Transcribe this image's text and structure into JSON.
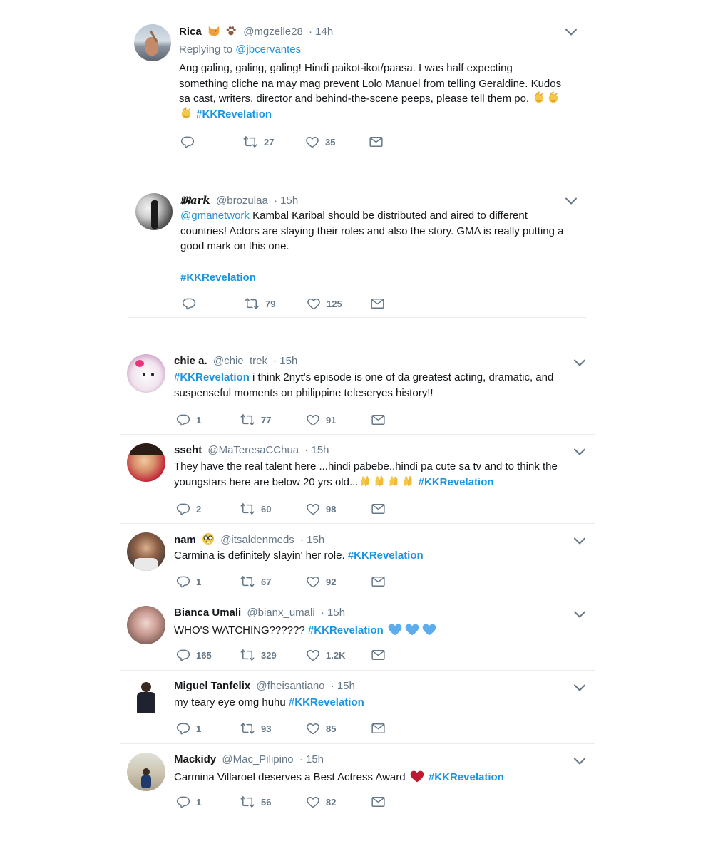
{
  "tweets": [
    {
      "name": "Rica",
      "name_emojis": [
        "cat-face-emoji",
        "paw-prints-emoji"
      ],
      "handle": "@mgzelle28",
      "time": "· 14h",
      "replying_label": "Replying to",
      "replying_handle": "@jbcervantes",
      "lines": [
        "Ang galing, galing, galing! Hindi paikot-ikot/paasa. I was half expecting",
        "something cliche na may mag prevent Lolo Manuel from telling Geraldine. Kudos",
        "sa cast, writers, director and behind-the-scene peeps, please tell them po."
      ],
      "hashtag": "#KKRevelation",
      "reply_count": "",
      "retweet_count": "27",
      "like_count": "35"
    },
    {
      "name": "𝕸ark",
      "handle": "@brozulaa",
      "time": "· 15h",
      "mention": "@gmanetwork",
      "lines": [
        "Kambal Karibal should be distributed and aired to different",
        "countries! Actors are slaying their roles and also the story. GMA is really putting a",
        "good mark on this one."
      ],
      "hashtag": "#KKRevelation",
      "reply_count": "",
      "retweet_count": "79",
      "like_count": "125"
    },
    {
      "name": "chie a.",
      "handle": "@chie_trek",
      "time": "· 15h",
      "hashtag": "#KKRevelation",
      "lines": [
        "i think 2nyt's episode is one of da greatest acting, dramatic, and",
        "suspenseful moments on philippine teleseryes history!!"
      ],
      "reply_count": "1",
      "retweet_count": "77",
      "like_count": "91"
    },
    {
      "name": "sseht",
      "handle": "@MaTeresaCChua",
      "time": "· 15h",
      "lines": [
        "They have the real talent here ...hindi pabebe..hindi pa cute sa tv and to think the",
        "youngstars here are below 20 yrs old..."
      ],
      "hashtag": "#KKRevelation",
      "reply_count": "2",
      "retweet_count": "60",
      "like_count": "98"
    },
    {
      "name": "nam",
      "handle": "@itsaldenmeds",
      "time": "· 15h",
      "text": "Carmina is definitely slayin' her role.",
      "hashtag": "#KKRevelation",
      "reply_count": "1",
      "retweet_count": "67",
      "like_count": "92"
    },
    {
      "name": "Bianca Umali",
      "handle": "@bianx_umali",
      "time": "· 15h",
      "text": "WHO'S WATCHING??????",
      "hashtag": "#KKRevelation",
      "reply_count": "165",
      "retweet_count": "329",
      "like_count": "1.2K"
    },
    {
      "name": "Miguel Tanfelix",
      "handle": "@fheisantiano",
      "time": "· 15h",
      "text": "my teary eye omg huhu",
      "hashtag": "#KKRevelation",
      "reply_count": "1",
      "retweet_count": "93",
      "like_count": "85"
    },
    {
      "name": "Mackidy",
      "handle": "@Mac_Pilipino",
      "time": "· 15h",
      "text": "Carmina Villaroel deserves a Best Actress Award",
      "hashtag": "#KKRevelation",
      "reply_count": "1",
      "retweet_count": "56",
      "like_count": "82"
    }
  ],
  "icons": {
    "reply": "reply-icon",
    "retweet": "retweet-icon",
    "like": "heart-icon",
    "dm": "envelope-icon",
    "caret": "chevron-down-icon"
  },
  "colors": {
    "link": "#1b95e0",
    "muted": "#657786",
    "text": "#14171a",
    "divider": "#e6ecf0"
  }
}
